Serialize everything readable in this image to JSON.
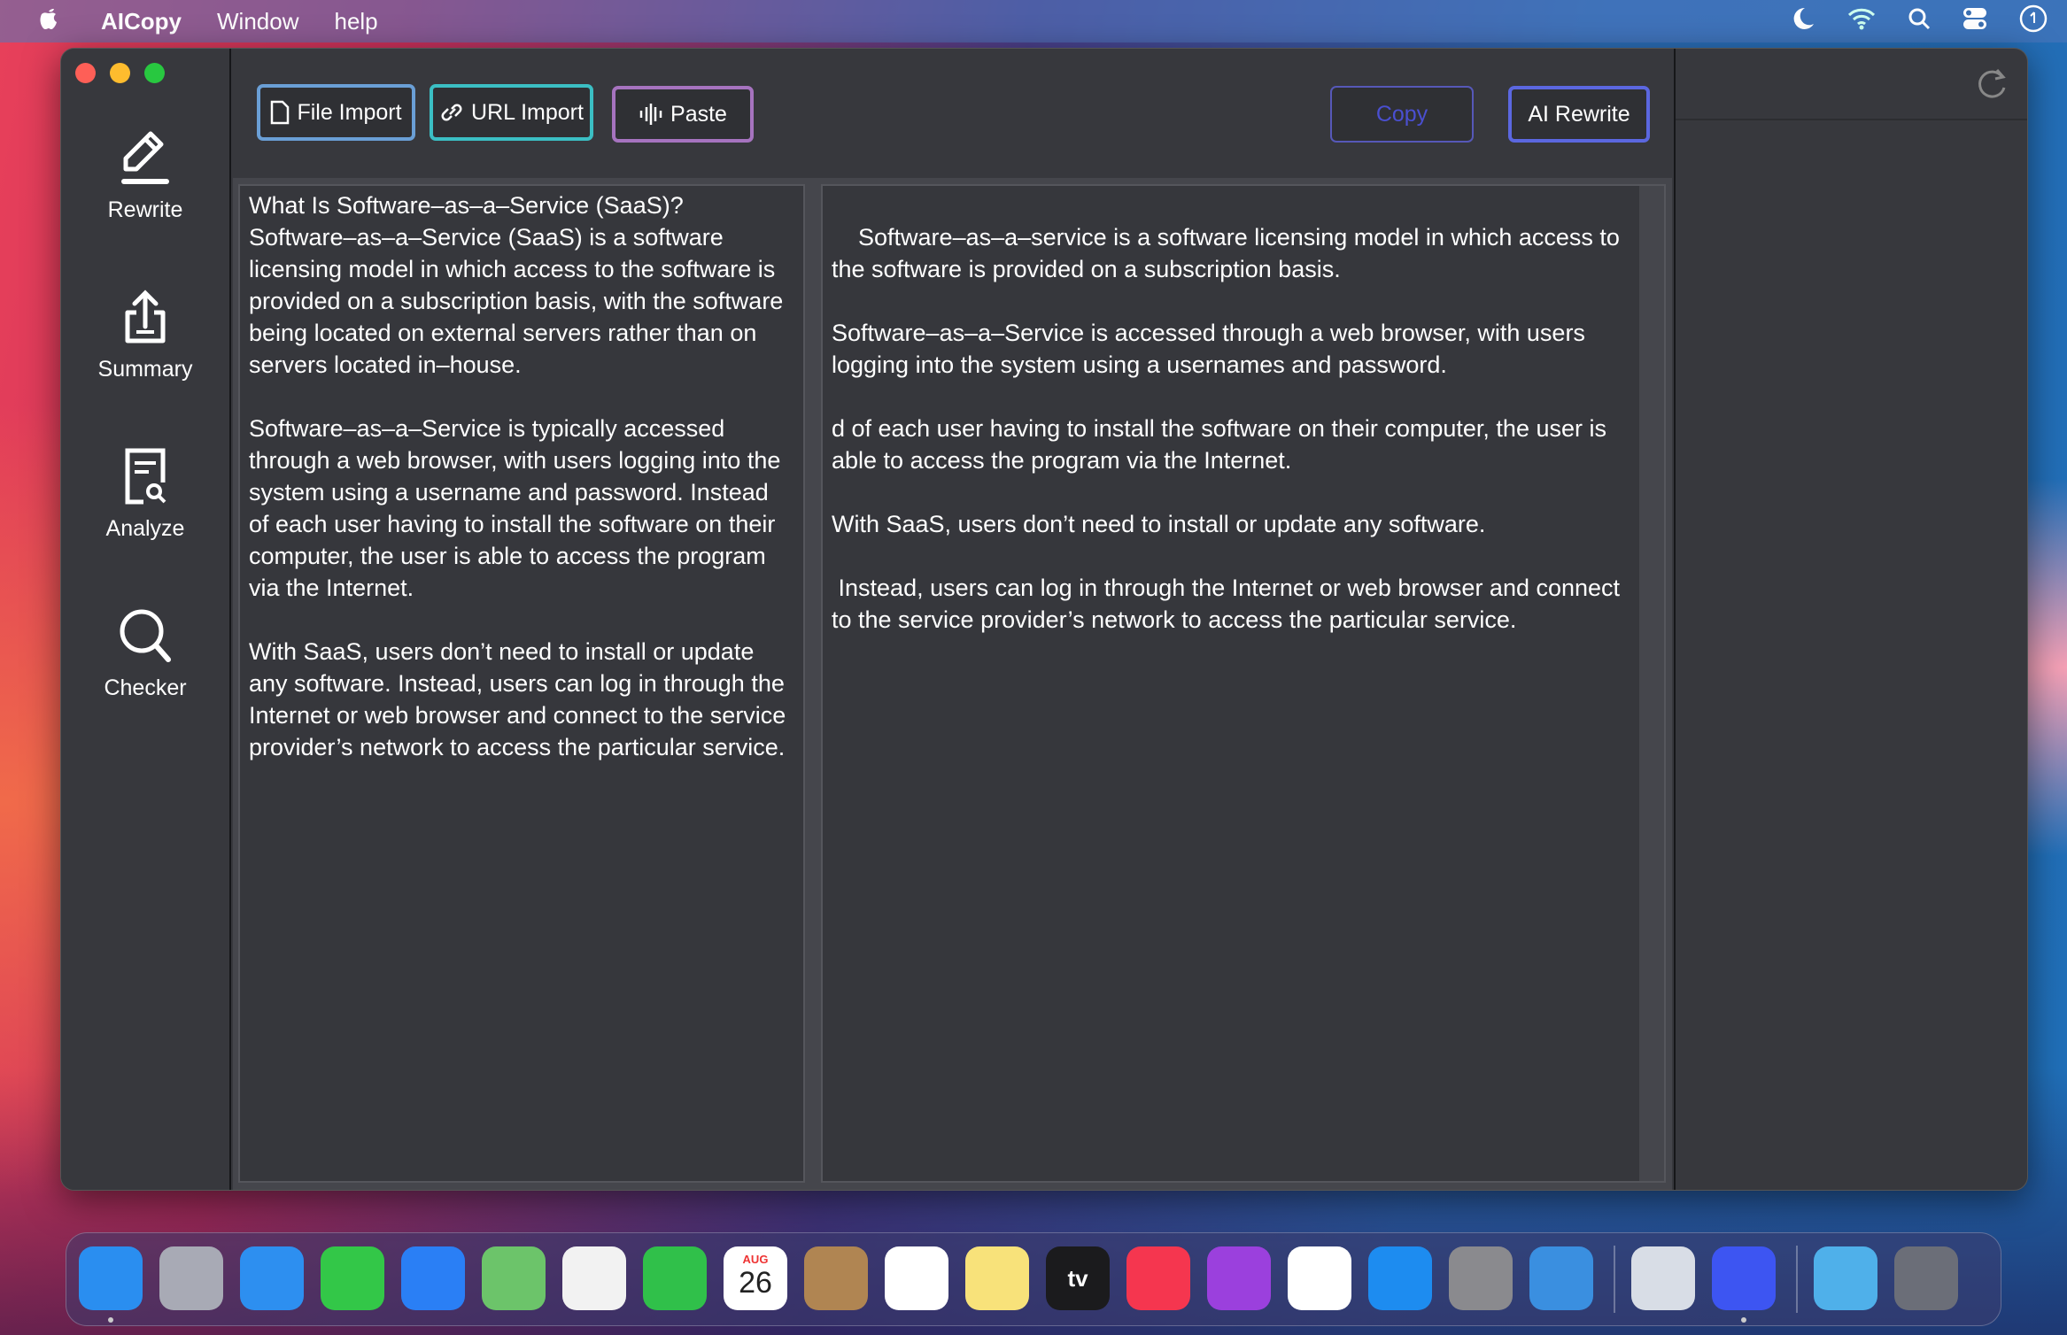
{
  "menubar": {
    "app": "AICopy",
    "items": [
      "Window",
      "help"
    ],
    "status_icons": [
      "moon-icon",
      "wifi-icon",
      "search-icon",
      "control-center-icon",
      "clock-icon"
    ]
  },
  "toolbar": {
    "file_import": "File Import",
    "url_import": "URL Import",
    "paste": "Paste",
    "copy": "Copy",
    "ai_rewrite": "AI Rewrite"
  },
  "colors": {
    "file_import": "#6a9fd6",
    "url_import": "#3bbfc4",
    "paste": "#a673bf",
    "copy_border": "#5658b8",
    "copy_text": "#4a4fd0",
    "ai_rewrite": "#5b67e0"
  },
  "sidebar": {
    "items": [
      {
        "label": "Rewrite",
        "icon": "pencil-icon"
      },
      {
        "label": "Summary",
        "icon": "share-upload-icon"
      },
      {
        "label": "Analyze",
        "icon": "document-search-icon"
      },
      {
        "label": "Checker",
        "icon": "magnifier-icon"
      }
    ]
  },
  "input_text": "What Is Software–as–a–Service (SaaS)?\nSoftware–as–a–Service (SaaS) is a software licensing model in which access to the software is provided on a subscription basis, with the software being located on external servers rather than on servers located in–house.\n\nSoftware–as–a–Service is typically accessed through a web browser, with users logging into the system using a username and password. Instead of each user having to install the software on their computer, the user is able to access the program via the Internet.\n\nWith SaaS, users don’t need to install or update any software. Instead, users can log in through the Internet or web browser and connect to the service provider’s network to access the particular service.",
  "output_text": "Software–as–a–service is a software licensing model in which access to the software is provided on a subscription basis.\n\nSoftware–as–a–Service is accessed through a web browser, with users logging into the system using a usernames and password.\n\nd of each user having to install the software on their computer, the user is able to access the program via the Internet.\n\nWith SaaS, users don’t need to install or update any software.\n\n Instead, users can log in through the Internet or web browser and connect to the service provider’s network to access the particular service.",
  "dock": {
    "calendar_month": "AUG",
    "calendar_day": "26",
    "tv_label": "tv",
    "apps": [
      {
        "name": "finder",
        "color": "#2a8ef0"
      },
      {
        "name": "launchpad",
        "color": "#a8aab5"
      },
      {
        "name": "safari",
        "color": "#2d8ff0"
      },
      {
        "name": "messages",
        "color": "#33c748"
      },
      {
        "name": "mail",
        "color": "#2a7ff5"
      },
      {
        "name": "maps",
        "color": "#6cc46a"
      },
      {
        "name": "photos",
        "color": "#f2f2f2"
      },
      {
        "name": "facetime",
        "color": "#30c04a"
      },
      {
        "name": "calendar",
        "color": "#ffffff"
      },
      {
        "name": "contacts",
        "color": "#b08552"
      },
      {
        "name": "reminders",
        "color": "#ffffff"
      },
      {
        "name": "notes",
        "color": "#f8e27a"
      },
      {
        "name": "tv",
        "color": "#1b1b1d"
      },
      {
        "name": "music",
        "color": "#f5364f"
      },
      {
        "name": "podcasts",
        "color": "#9b40dd"
      },
      {
        "name": "news",
        "color": "#ffffff"
      },
      {
        "name": "app-store",
        "color": "#1d8cf0"
      },
      {
        "name": "system-preferences",
        "color": "#8a8a8e"
      },
      {
        "name": "mountain-app",
        "color": "#3a8fe0"
      },
      {
        "name": "preview",
        "color": "#d8dde6"
      },
      {
        "name": "aicopy",
        "color": "#3d55f2"
      },
      {
        "name": "downloads-folder",
        "color": "#4fb0ea"
      },
      {
        "name": "trash",
        "color": "#6b6e78"
      }
    ]
  }
}
